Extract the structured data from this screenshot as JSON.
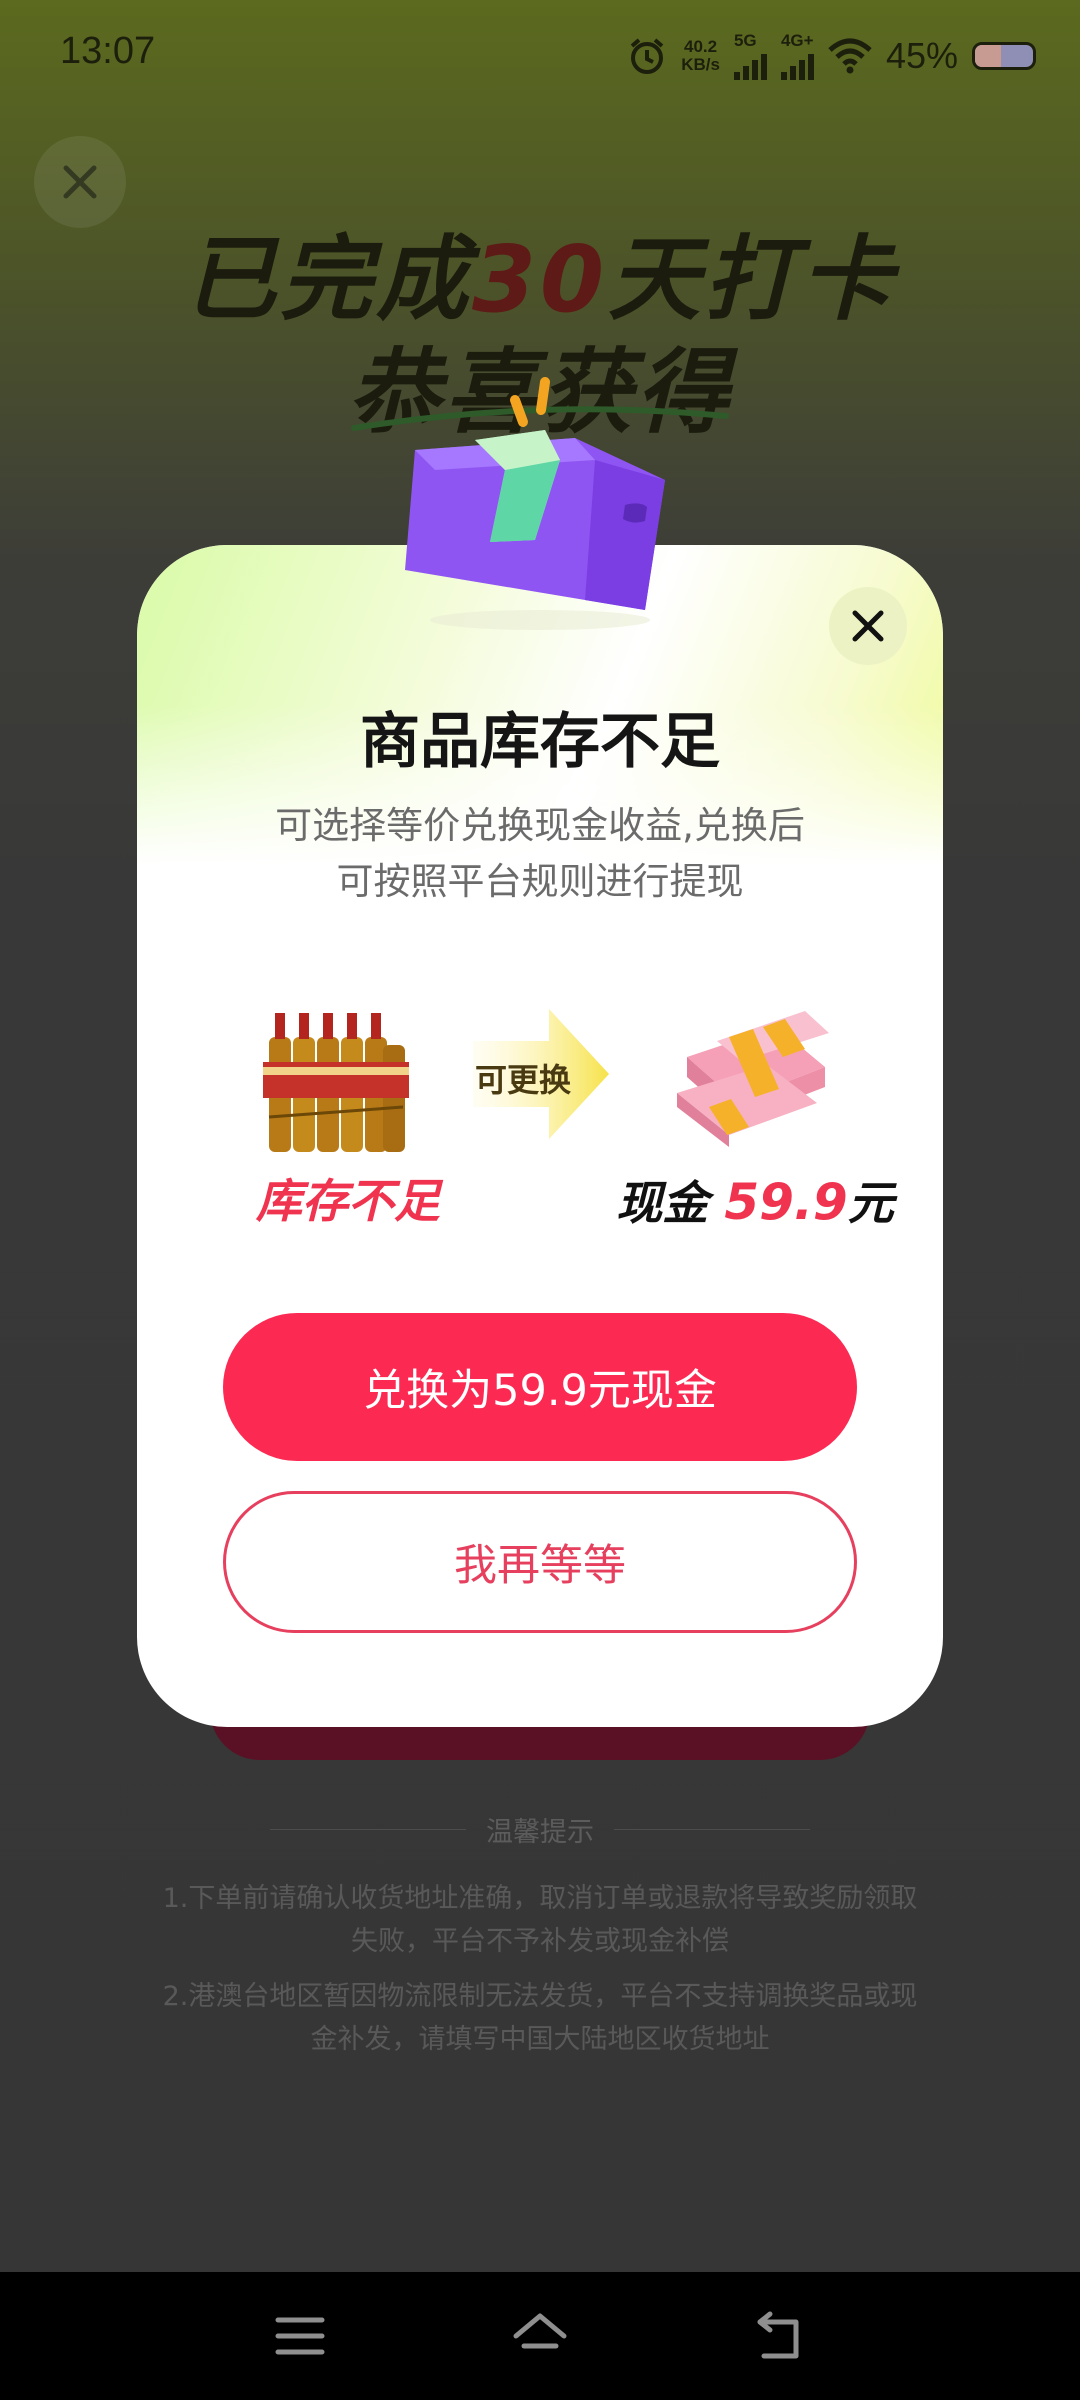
{
  "status_bar": {
    "time": "13:07",
    "speed_value": "40.2",
    "speed_unit": "KB/s",
    "network_1": "5G",
    "network_2": "4G+",
    "battery_percent": "45%",
    "battery_level": 0.45
  },
  "background": {
    "title_prefix": "已完成",
    "title_number": "30",
    "title_suffix": "天打卡",
    "subtitle": "恭喜获得",
    "tips_heading": "温馨提示",
    "tip_1": "1.下单前请确认收货地址准确，取消订单或退款将导致奖励领取失败，平台不予补发或现金补偿",
    "tip_2": "2.港澳台地区暂因物流限制无法发货，平台不支持调换奖品或现金补发，请填写中国大陆地区收货地址"
  },
  "modal": {
    "title": "商品库存不足",
    "desc_line_1": "可选择等价兑换现金收益,兑换后",
    "desc_line_2": "可按照平台规则进行提现",
    "arrow_label": "可更换",
    "stock_label": "库存不足",
    "cash_prefix": "现金",
    "cash_amount": "59.9",
    "cash_unit": "元",
    "exchange_button": "兑换为59.9元现金",
    "wait_button": "我再等等"
  },
  "colors": {
    "accent": "#fc2a53",
    "accent_text": "#f0344f",
    "nav_bg": "#000000"
  },
  "icons": {
    "close": "close-icon",
    "gift": "gift-box-icon",
    "nav_menu": "menu-icon",
    "nav_home": "home-icon",
    "nav_back": "back-icon"
  }
}
